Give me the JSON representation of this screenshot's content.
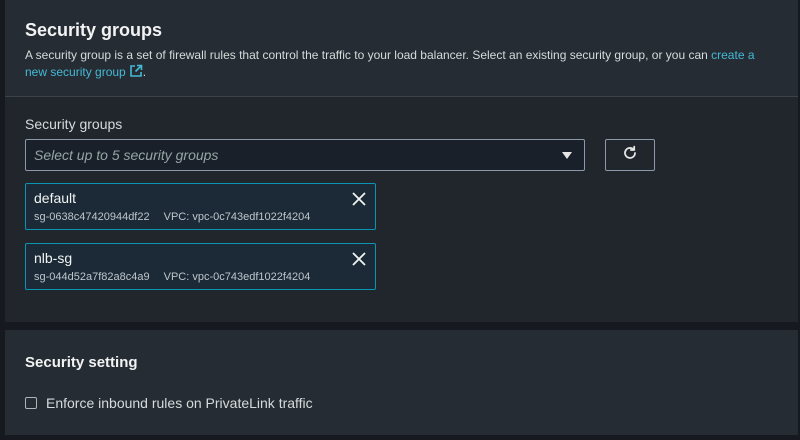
{
  "security_groups_section": {
    "title": "Security groups",
    "description_text": "A security group is a set of firewall rules that control the traffic to your load balancer. Select an existing security group, or you can ",
    "create_link_text": "create a new security group",
    "description_end": ".",
    "field_label": "Security groups",
    "select_placeholder": "Select up to 5 security groups",
    "refresh_icon": "refresh-icon",
    "selected_groups": [
      {
        "name": "default",
        "id": "sg-0638c47420944df22",
        "vpc": "VPC: vpc-0c743edf1022f4204"
      },
      {
        "name": "nlb-sg",
        "id": "sg-044d52a7f82a8c4a9",
        "vpc": "VPC: vpc-0c743edf1022f4204"
      }
    ]
  },
  "security_setting_section": {
    "title": "Security setting",
    "checkbox_label": "Enforce inbound rules on PrivateLink traffic",
    "checkbox_checked": false
  },
  "colors": {
    "link": "#44b9d6",
    "token_border": "#0a95b5",
    "panel_bg": "#262c33"
  }
}
